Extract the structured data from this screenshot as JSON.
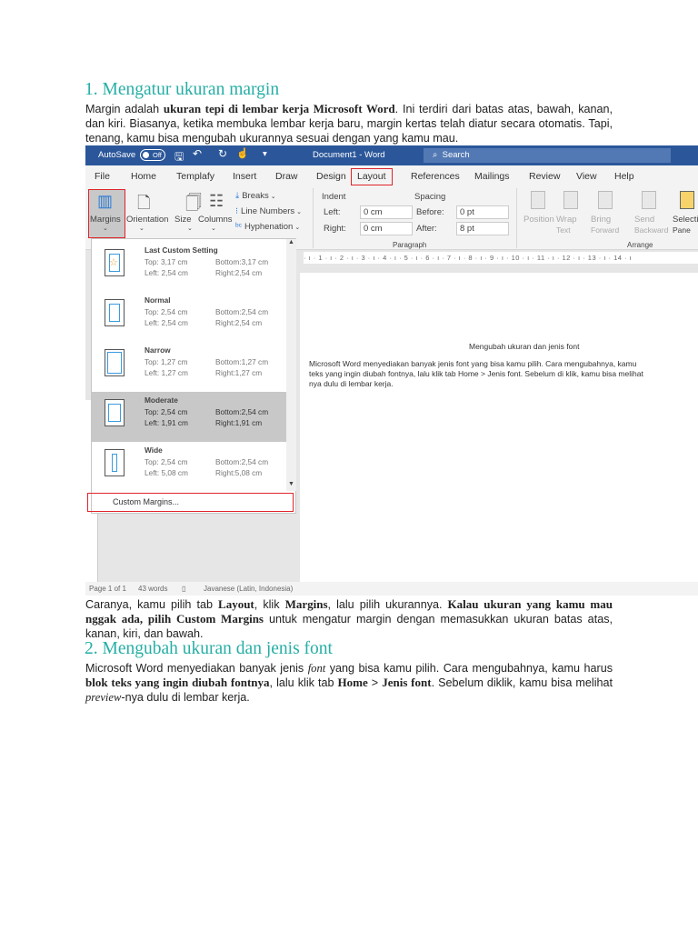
{
  "section1": {
    "heading": "1. Mengatur ukuran margin",
    "para": [
      {
        "t": "Margin adalah "
      },
      {
        "b": "ukuran tepi di lembar kerja Microsoft Word"
      },
      {
        "t": ". Ini terdiri dari batas atas, bawah, kanan, dan kiri. Biasanya, ketika membuka lembar kerja baru, margin kertas telah diatur secara otomatis. Tapi, tenang, kamu bisa mengubah ukurannya sesuai dengan yang kamu mau."
      }
    ],
    "para2": [
      {
        "t": "Caranya, kamu pilih tab "
      },
      {
        "b": "Layout"
      },
      {
        "t": ", klik "
      },
      {
        "b": "Margins"
      },
      {
        "t": ", lalu pilih ukurannya. "
      },
      {
        "b": "Kalau ukuran yang kamu mau nggak ada, pilih Custom Margins"
      },
      {
        "t": " untuk mengatur margin dengan memasukkan ukuran batas atas, kanan, kiri, dan bawah."
      }
    ]
  },
  "section2": {
    "heading": "2. Mengubah ukuran dan jenis font",
    "para": [
      {
        "t": "Microsoft Word menyediakan banyak jenis "
      },
      {
        "i": "font"
      },
      {
        "t": " yang bisa kamu pilih. Cara mengubahnya, kamu harus "
      },
      {
        "b": "blok teks yang ingin diubah fontnya"
      },
      {
        "t": ", lalu  klik tab "
      },
      {
        "b": "Home"
      },
      {
        "t": " > "
      },
      {
        "b": "Jenis font"
      },
      {
        "t": ". Sebelum diklik, kamu bisa melihat "
      },
      {
        "i": "preview"
      },
      {
        "t": "-nya dulu di lembar kerja."
      }
    ]
  },
  "word": {
    "titlebar": {
      "autosave": "AutoSave",
      "toggle": "Off",
      "title": "Document1  -  Word",
      "search": "Search",
      "color": "#2b579a"
    },
    "tabs": [
      "File",
      "Home",
      "Templafy",
      "Insert",
      "Draw",
      "Design",
      "Layout",
      "References",
      "Mailings",
      "Review",
      "View",
      "Help"
    ],
    "active_tab": "Layout",
    "page_setup": [
      "Margins",
      "Orientation",
      "Size",
      "Columns"
    ],
    "page_setup_small": [
      "Breaks",
      "Line Numbers",
      "Hyphenation"
    ],
    "indent": {
      "label": "Indent",
      "left_label": "Left:",
      "left": "0 cm",
      "right_label": "Right:",
      "right": "0 cm"
    },
    "spacing": {
      "label": "Spacing",
      "before_label": "Before:",
      "before": "0 pt",
      "after_label": "After:",
      "after": "8 pt"
    },
    "group_paragraph": "Paragraph",
    "group_arrange": "Arrange",
    "arrange": [
      [
        "Position",
        ""
      ],
      [
        "Wrap",
        "Text"
      ],
      [
        "Bring",
        "Forward"
      ],
      [
        "Send",
        "Backward"
      ],
      [
        "Selecti",
        "Pane"
      ]
    ],
    "margins_menu": [
      {
        "name": "Last Custom Setting",
        "top": "Top: 3,17 cm",
        "bottom": "Bottom:3,17 cm",
        "left": "Left:  2,54 cm",
        "right": "Right:2,54 cm"
      },
      {
        "name": "Normal",
        "top": "Top: 2,54 cm",
        "bottom": "Bottom:2,54 cm",
        "left": "Left:  2,54 cm",
        "right": "Right:2,54 cm"
      },
      {
        "name": "Narrow",
        "top": "Top: 1,27 cm",
        "bottom": "Bottom:1,27 cm",
        "left": "Left:  1,27 cm",
        "right": "Right:1,27 cm"
      },
      {
        "name": "Moderate",
        "top": "Top: 2,54 cm",
        "bottom": "Bottom:2,54 cm",
        "left": "Left:  1,91 cm",
        "right": "Right:1,91 cm"
      },
      {
        "name": "Wide",
        "top": "Top: 2,54 cm",
        "bottom": "Bottom:2,54 cm",
        "left": "Left:  5,08 cm",
        "right": "Right:5,08 cm"
      }
    ],
    "selected_margin": "Moderate",
    "custom_margins": "Custom Margins...",
    "ruler": "· ı · 1 · ı · 2 · ı · 3 · ı · 4 · ı · 5 · ı · 6 · ı · 7 · ı · 8 · ı · 9 · ı · 10 · ı · 11 · ı · 12 · ı · 13 · ı · 14 · ı",
    "page": {
      "title": "Mengubah ukuran dan jenis font",
      "lines": [
        "Microsoft Word menyediakan banyak jenis font yang bisa kamu pilih. Cara mengubahnya, kamu",
        "teks yang ingin diubah fontnya, lalu klik tab Home > Jenis font. Sebelum di klik, kamu bisa melihat",
        "nya dulu di lembar kerja."
      ]
    },
    "status": {
      "page": "Page 1 of 1",
      "words": "43 words",
      "language": "Javanese (Latin, Indonesia)"
    },
    "highlight_color": "#e0242b"
  }
}
